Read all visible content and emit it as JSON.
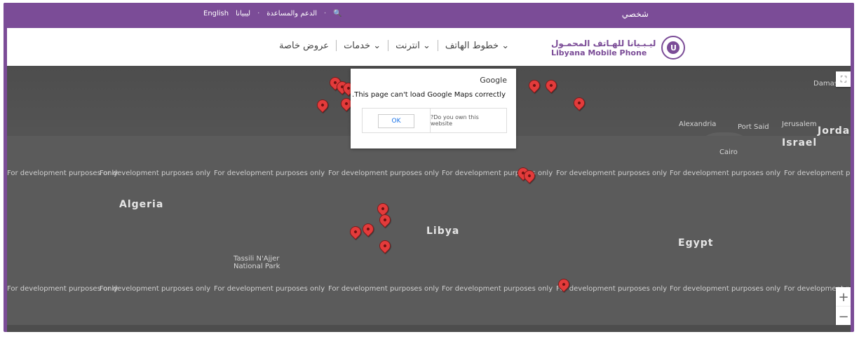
{
  "topbar": {
    "english": "English",
    "libyana": "ليبيانا",
    "support": "الدعم والمساعدة",
    "search": "search-icon",
    "account": "شخصي"
  },
  "nav": {
    "items": [
      "عروض خاصة",
      "خدمات",
      "انترنت",
      "خطوط الهاتف"
    ],
    "brand_ar": "ليـبـيانا للهـاتف المحمـول",
    "brand_en": "Libyana Mobile Phone"
  },
  "map": {
    "countries": [
      "Algeria",
      "Libya",
      "Egypt",
      "Israel",
      "Jordan"
    ],
    "small_labels": [
      "Alexandria",
      "Cairo",
      "Port Said",
      "Jerusalem",
      "Damascus",
      "Tassili N'Ajjer National Park"
    ],
    "dev_text": "For development purposes only",
    "dialog": {
      "brand": "Google",
      "message": ".This page can't load Google Maps correctly",
      "ok": "OK",
      "own_site": "?Do you own this website"
    },
    "controls": {
      "fullscreen": "fullscreen-icon",
      "zoom_in": "+",
      "zoom_out": "−"
    }
  }
}
